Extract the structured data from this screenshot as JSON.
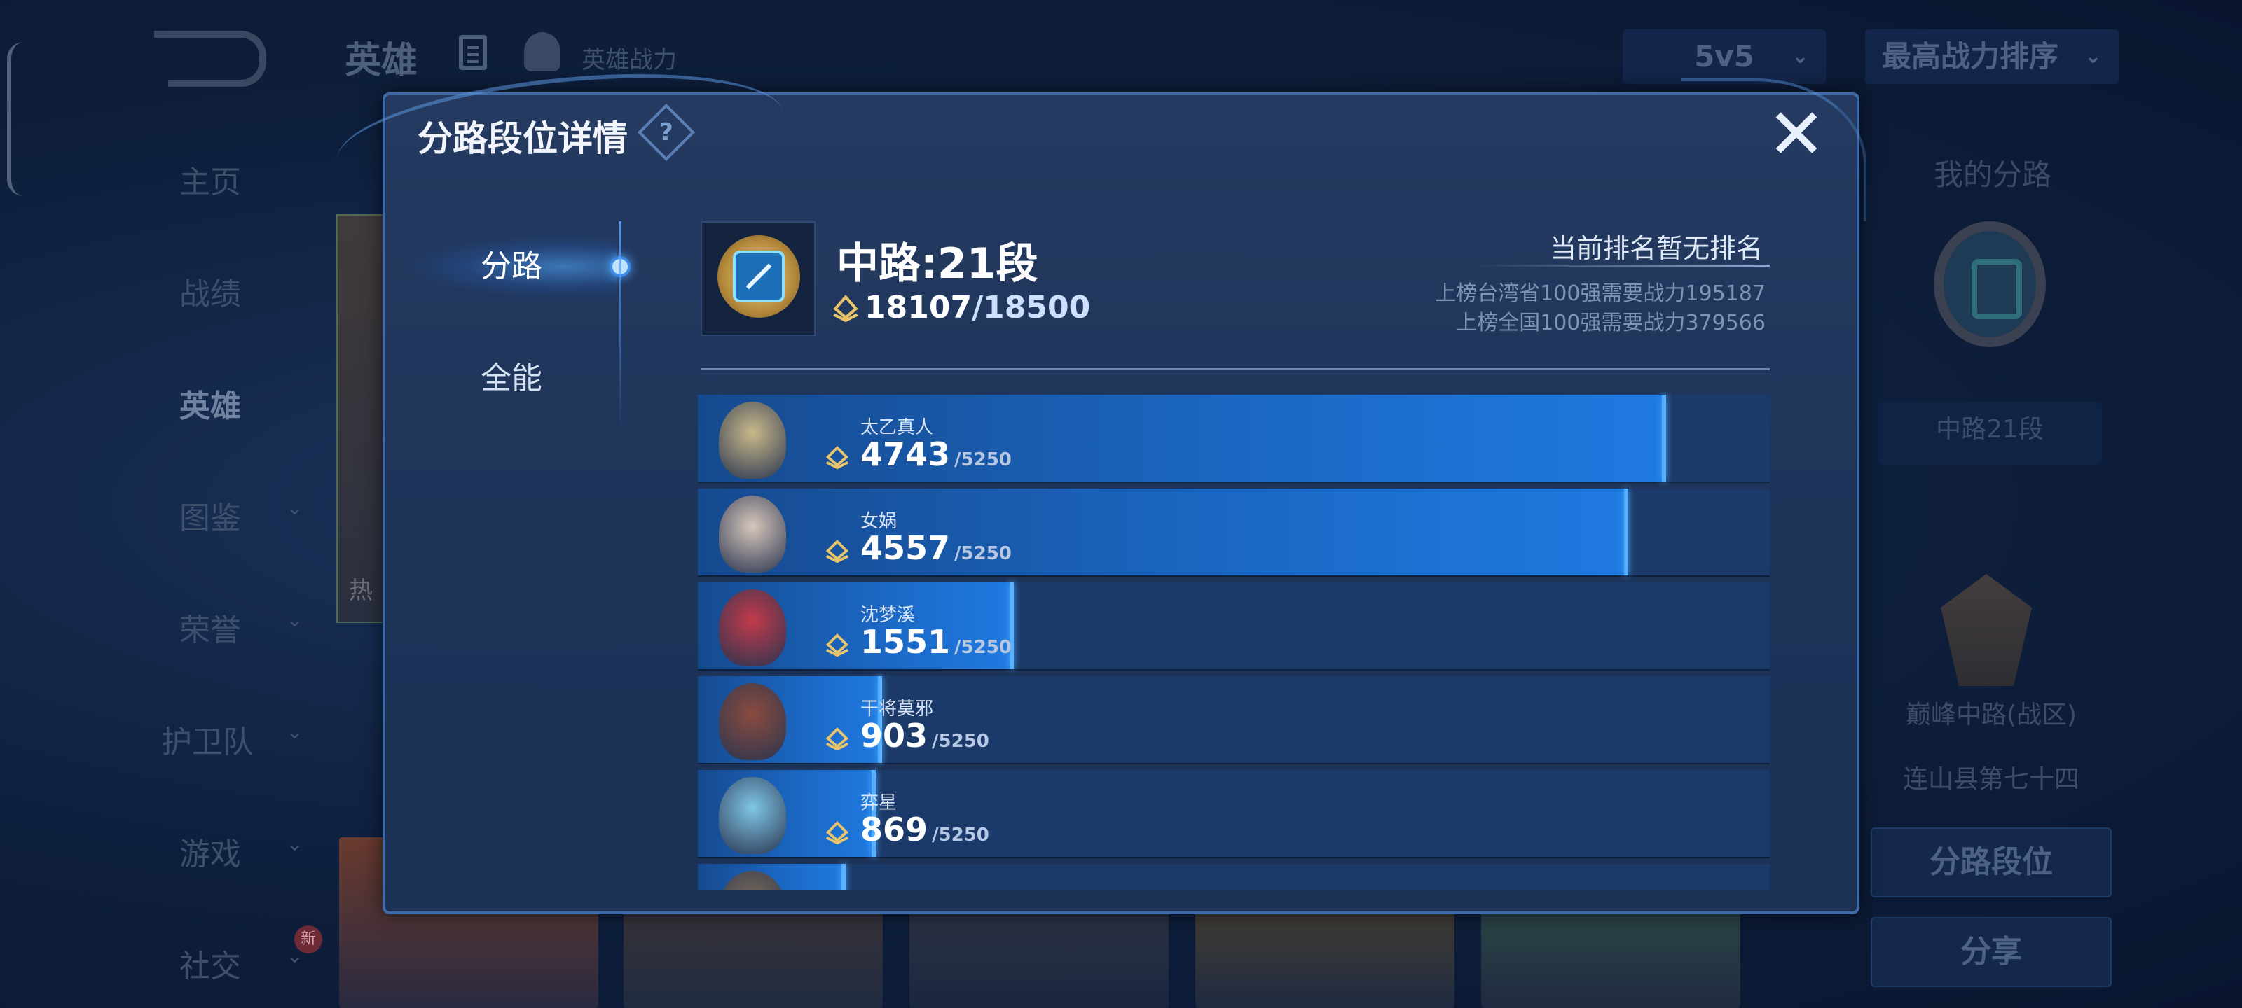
{
  "app": {
    "top_title": "英雄",
    "top_power_label": "英雄战力",
    "mode_select": "5v5",
    "sort_select": "最高战力排序"
  },
  "nav": {
    "items": [
      {
        "label": "主页",
        "chevron": false
      },
      {
        "label": "战绩",
        "chevron": false
      },
      {
        "label": "英雄",
        "chevron": false,
        "active": true
      },
      {
        "label": "图鉴",
        "chevron": true
      },
      {
        "label": "荣誉",
        "chevron": true
      },
      {
        "label": "护卫队",
        "chevron": true
      },
      {
        "label": "游戏",
        "chevron": true
      },
      {
        "label": "社交",
        "chevron": true,
        "badge": "新"
      }
    ]
  },
  "left_card_text": "热",
  "right_panel": {
    "title": "我的分路",
    "lane": "中路21段",
    "peak": "巅峰中路(战区)",
    "region": "连山县第七十四",
    "btn_lane_rank": "分路段位",
    "btn_share": "分享"
  },
  "modal": {
    "title": "分路段位详情",
    "help": "?",
    "close": "✕",
    "tabs": [
      "分路",
      "全能"
    ],
    "active_tab": 0,
    "lane_title": "中路:21段",
    "score_current": "18107",
    "score_target": "/18500",
    "rank_status": "当前排名暂无排名",
    "rank_req_province": "上榜台湾省100强需要战力195187",
    "rank_req_national": "上榜全国100强需要战力379566"
  },
  "heroes": [
    {
      "name": "太乙真人",
      "value": 4743,
      "max": "/5250",
      "value_text": "4743",
      "progress": 0.903,
      "color": "#c9b98a"
    },
    {
      "name": "女娲",
      "value": 4557,
      "max": "/5250",
      "value_text": "4557",
      "progress": 0.868,
      "color": "#d7c7bc"
    },
    {
      "name": "沈梦溪",
      "value": 1551,
      "max": "/5250",
      "value_text": "1551",
      "progress": 0.295,
      "color": "#c23a4a"
    },
    {
      "name": "干将莫邪",
      "value": 903,
      "max": "/5250",
      "value_text": "903",
      "progress": 0.172,
      "color": "#8a4b3e"
    },
    {
      "name": "弈星",
      "value": 869,
      "max": "/5250",
      "value_text": "869",
      "progress": 0.166,
      "color": "#7fc6e6"
    },
    {
      "name": "",
      "value": null,
      "max": "",
      "value_text": "",
      "progress": 0.138,
      "color": "#7a6a5a"
    }
  ],
  "colors": {
    "modal_bg": "#1f3559",
    "bar_fill": "#1b69c6",
    "bar_track": "#1b3a69",
    "accent": "#55b0ff"
  }
}
